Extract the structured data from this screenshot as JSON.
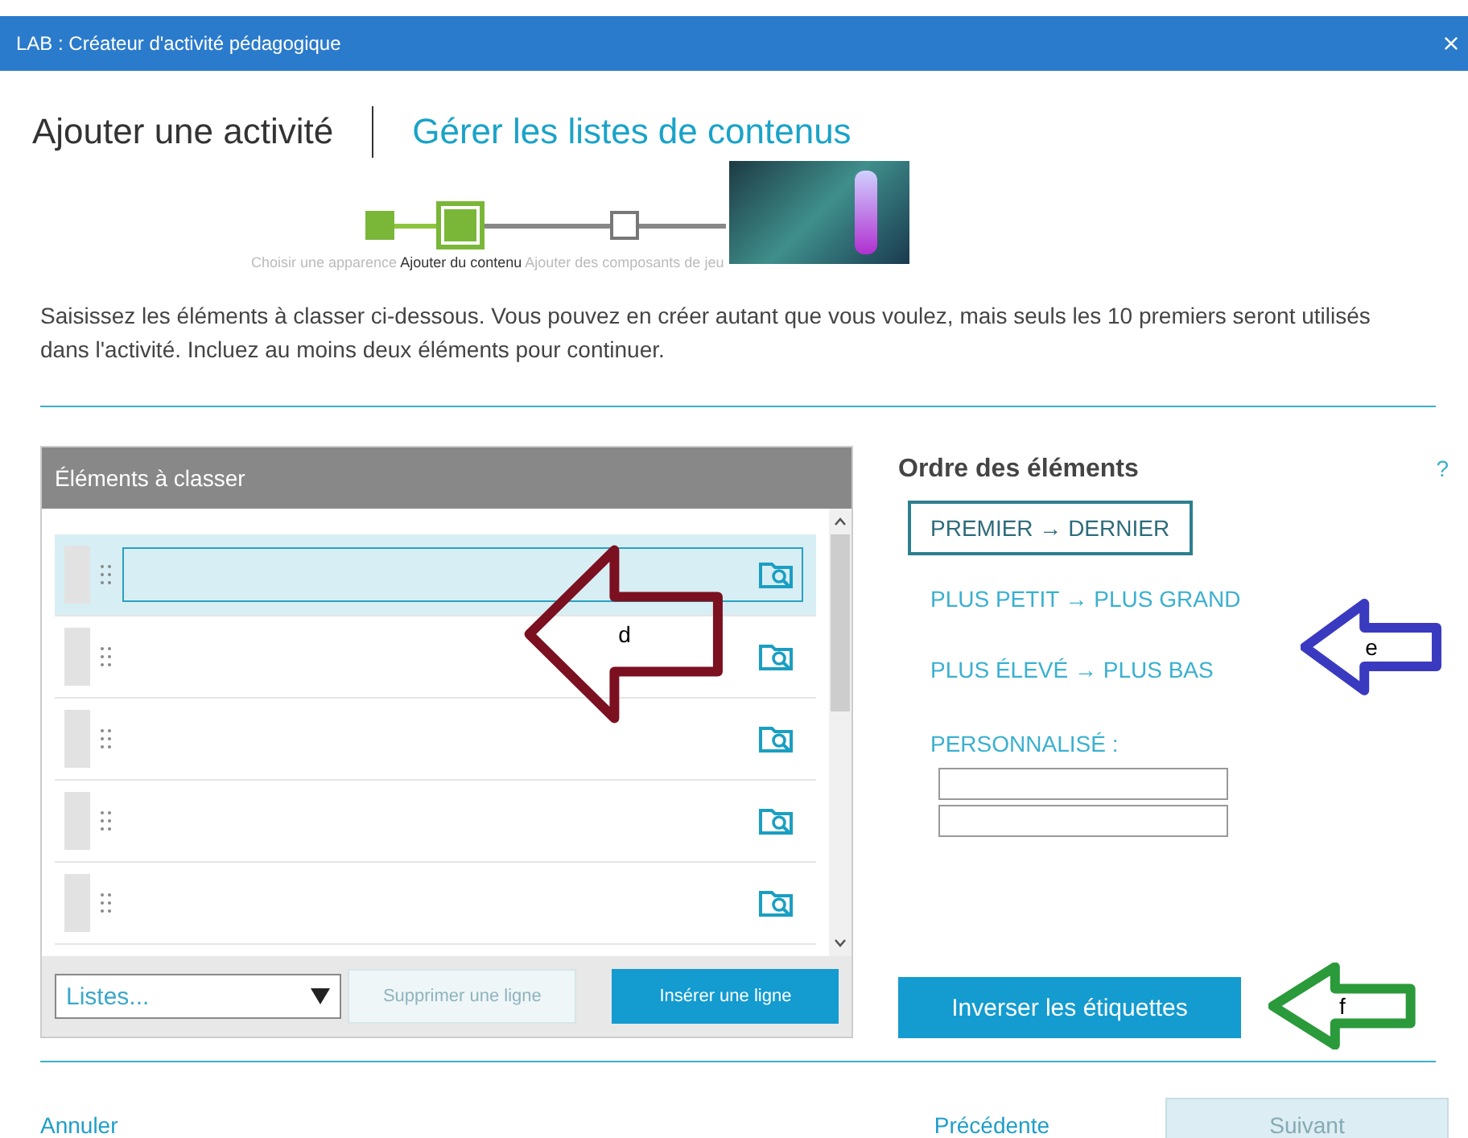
{
  "window": {
    "title": "LAB : Créateur d'activité pédagogique"
  },
  "tabs": [
    {
      "label": "Ajouter une activité",
      "selected": true
    },
    {
      "label": "Gérer les listes de contenus",
      "selected": false
    }
  ],
  "steps": [
    {
      "label": "Choisir une apparence",
      "kind": "done"
    },
    {
      "label": "Ajouter du contenu",
      "kind": "current"
    },
    {
      "label": "Ajouter des composants de jeu",
      "kind": "pending"
    }
  ],
  "instructions": "Saisissez les éléments à classer ci-dessous. Vous pouvez en créer autant que vous voulez, mais seuls les 10 premiers seront utilisés dans l'activité. Incluez au moins deux éléments pour continuer.",
  "items_panel": {
    "title": "Éléments à classer",
    "rows": [
      {
        "selected": true
      },
      {
        "selected": false
      },
      {
        "selected": false
      },
      {
        "selected": false
      },
      {
        "selected": false
      }
    ],
    "lists_dropdown": {
      "value": "Listes..."
    },
    "delete_button": {
      "label": "Supprimer une ligne",
      "disabled": true
    },
    "insert_button": {
      "label": "Insérer une ligne",
      "disabled": false
    }
  },
  "order_panel": {
    "title": "Ordre des éléments",
    "help": "?",
    "options": [
      {
        "label": "PREMIER → DERNIER",
        "kind": "preset",
        "selected": true
      },
      {
        "label": "PLUS PETIT → PLUS GRAND",
        "kind": "preset",
        "selected": false
      },
      {
        "label": "PLUS ÉLEVÉ → PLUS BAS",
        "kind": "preset",
        "selected": false
      },
      {
        "label": "PERSONNALISÉ :",
        "kind": "custom",
        "selected": false
      }
    ],
    "invert_button": "Inverser les étiquettes"
  },
  "footer": {
    "cancel": "Annuler",
    "previous": "Précédente",
    "next": {
      "label": "Suivant",
      "disabled": true
    }
  },
  "annotations": [
    {
      "label": "d",
      "color": "#7b1020"
    },
    {
      "label": "e",
      "color": "#3a3ac0"
    },
    {
      "label": "f",
      "color": "#2a9a3a"
    }
  ]
}
